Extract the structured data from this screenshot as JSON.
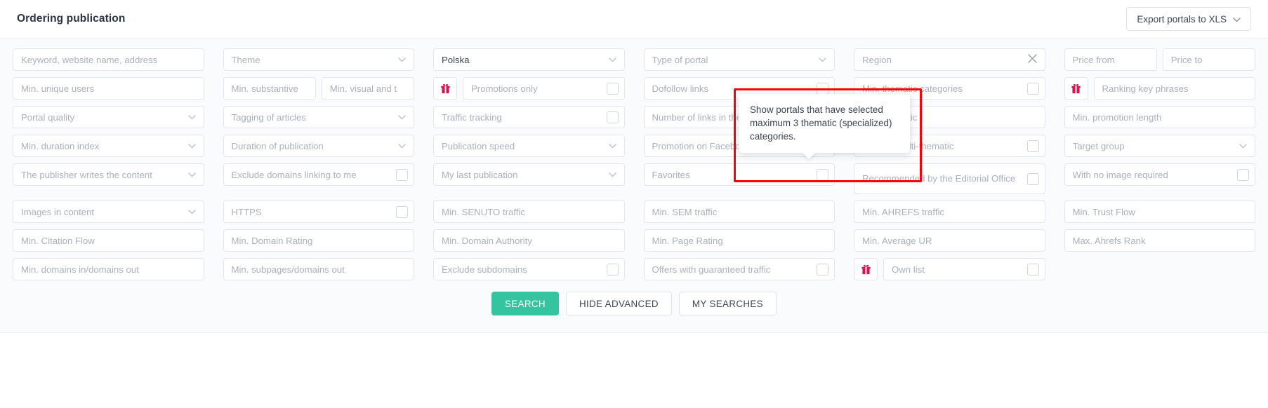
{
  "header": {
    "title": "Ordering publication",
    "export_label": "Export portals to XLS",
    "chevron": "⌄"
  },
  "icons": {
    "chevron_down": "⌄",
    "clear": "✕",
    "gift": "gift-icon"
  },
  "filters": {
    "rows": [
      [
        {
          "type": "text",
          "label": "Keyword, website name, address"
        },
        {
          "type": "select",
          "label": "Theme"
        },
        {
          "type": "select",
          "label": "Polska",
          "filled": true
        },
        {
          "type": "select",
          "label": "Type of portal"
        },
        {
          "type": "clear",
          "label": "Region"
        },
        {
          "type": "pair",
          "label": "Price from",
          "label2": "Price to"
        }
      ],
      [
        {
          "type": "text",
          "label": "Min. unique users"
        },
        {
          "type": "pair",
          "label": "Min. substantive",
          "label2": "Min. visual and t"
        },
        {
          "type": "check",
          "label": "Promotions only",
          "gift": true
        },
        {
          "type": "check",
          "label": "Dofollow links"
        },
        {
          "type": "check",
          "label": "Min. thematic categories"
        },
        {
          "type": "text",
          "label": "Ranking key phrases",
          "gift": true
        }
      ],
      [
        {
          "type": "select",
          "label": "Portal quality"
        },
        {
          "type": "select",
          "label": "Tagging of articles"
        },
        {
          "type": "check",
          "label": "Traffic tracking"
        },
        {
          "type": "select",
          "label": "Number of links in the content"
        },
        {
          "type": "text",
          "label": "Min. thematic"
        },
        {
          "type": "text",
          "label": "Min. promotion length"
        }
      ],
      [
        {
          "type": "select",
          "label": "Min. duration index"
        },
        {
          "type": "select",
          "label": "Duration of publication"
        },
        {
          "type": "select",
          "label": "Publication speed"
        },
        {
          "type": "check",
          "label": "Promotion on Facebook"
        },
        {
          "type": "check",
          "label": "Without multi-thematic"
        },
        {
          "type": "select",
          "label": "Target group"
        }
      ],
      [
        {
          "type": "select",
          "label": "The publisher writes the content"
        },
        {
          "type": "check",
          "label": "Exclude domains linking to me"
        },
        {
          "type": "select",
          "label": "My last publication"
        },
        {
          "type": "check",
          "label": "Favorites"
        },
        {
          "type": "check",
          "label": "Recommended by the Editorial Office",
          "tall": true
        },
        {
          "type": "check",
          "label": "With no image required"
        }
      ],
      [
        {
          "type": "select",
          "label": "Images in content"
        },
        {
          "type": "check",
          "label": "HTTPS"
        },
        {
          "type": "text",
          "label": "Min. SENUTO traffic"
        },
        {
          "type": "text",
          "label": "Min. SEM traffic"
        },
        {
          "type": "text",
          "label": "Min. AHREFS traffic"
        },
        {
          "type": "text",
          "label": "Min. Trust Flow"
        }
      ],
      [
        {
          "type": "text",
          "label": "Min. Citation Flow"
        },
        {
          "type": "text",
          "label": "Min. Domain Rating"
        },
        {
          "type": "text",
          "label": "Min. Domain Authority"
        },
        {
          "type": "text",
          "label": "Min. Page Rating"
        },
        {
          "type": "text",
          "label": "Min. Average UR"
        },
        {
          "type": "text",
          "label": "Max. Ahrefs Rank"
        }
      ],
      [
        {
          "type": "text",
          "label": "Min. domains in/domains out"
        },
        {
          "type": "text",
          "label": "Min. subpages/domains out"
        },
        {
          "type": "check",
          "label": "Exclude subdomains"
        },
        {
          "type": "check",
          "label": "Offers with guaranteed traffic"
        },
        {
          "type": "check",
          "label": "Own list",
          "gift": true
        },
        {
          "type": "empty",
          "label": ""
        }
      ]
    ]
  },
  "tooltip": {
    "text": "Show portals that have selected maximum 3 thematic (specialized) categories."
  },
  "actions": {
    "search": "SEARCH",
    "hide_advanced": "HIDE ADVANCED",
    "my_searches": "MY SEARCHES"
  },
  "colors": {
    "accent": "#35c4a0",
    "highlight": "#fb0007",
    "gift": "#d5134f",
    "title": "#2b3445"
  }
}
